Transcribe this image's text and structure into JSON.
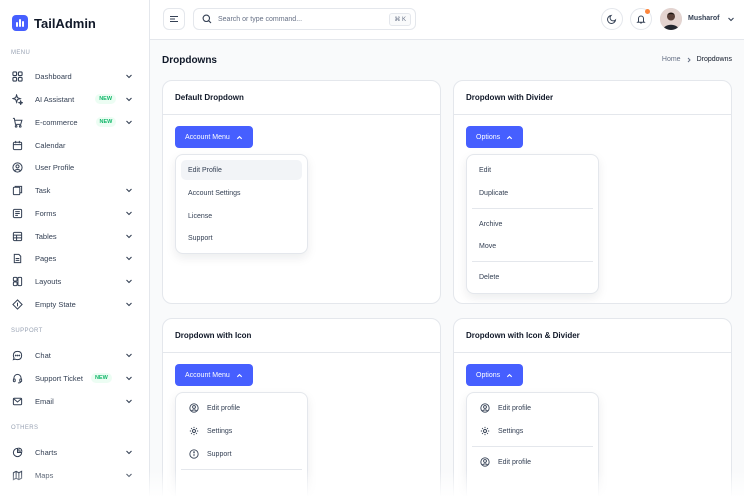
{
  "brand": {
    "name": "TailAdmin",
    "color": "#465fff"
  },
  "sidebar": {
    "sections": {
      "menu": "MENU",
      "support": "SUPPORT",
      "others": "OTHERS"
    },
    "items": [
      {
        "label": "Dashboard",
        "icon": "grid-icon",
        "badge": "",
        "chevron": true
      },
      {
        "label": "AI Assistant",
        "icon": "sparkle-icon",
        "badge": "NEW",
        "chevron": true
      },
      {
        "label": "E-commerce",
        "icon": "cart-icon",
        "badge": "NEW",
        "chevron": true
      },
      {
        "label": "Calendar",
        "icon": "calendar-icon",
        "badge": "",
        "chevron": false
      },
      {
        "label": "User Profile",
        "icon": "user-circle-icon",
        "badge": "",
        "chevron": false
      },
      {
        "label": "Task",
        "icon": "task-icon",
        "badge": "",
        "chevron": true
      },
      {
        "label": "Forms",
        "icon": "form-icon",
        "badge": "",
        "chevron": true
      },
      {
        "label": "Tables",
        "icon": "table-icon",
        "badge": "",
        "chevron": true
      },
      {
        "label": "Pages",
        "icon": "page-icon",
        "badge": "",
        "chevron": true
      },
      {
        "label": "Layouts",
        "icon": "layout-icon",
        "badge": "",
        "chevron": true
      },
      {
        "label": "Empty State",
        "icon": "empty-state-icon",
        "badge": "",
        "chevron": true
      },
      {
        "label": "Chat",
        "icon": "chat-icon",
        "badge": "",
        "chevron": true
      },
      {
        "label": "Support Ticket",
        "icon": "headset-icon",
        "badge": "NEW",
        "chevron": true
      },
      {
        "label": "Email",
        "icon": "mail-icon",
        "badge": "",
        "chevron": true
      },
      {
        "label": "Charts",
        "icon": "pie-chart-icon",
        "badge": "",
        "chevron": true
      },
      {
        "label": "Maps",
        "icon": "map-icon",
        "badge": "",
        "chevron": true
      }
    ]
  },
  "header": {
    "search_placeholder": "Search or type command...",
    "shortcut": "⌘ K",
    "user_name": "Musharof"
  },
  "page": {
    "title": "Dropdowns",
    "breadcrumb": {
      "home": "Home",
      "current": "Dropdowns"
    }
  },
  "cards": {
    "default": {
      "title": "Default Dropdown",
      "button": "Account Menu",
      "items": [
        "Edit Profile",
        "Account Settings",
        "License",
        "Support"
      ]
    },
    "divider": {
      "title": "Dropdown with Divider",
      "button": "Options",
      "items": [
        "Edit",
        "Duplicate",
        "Archive",
        "Move",
        "Delete"
      ]
    },
    "icon": {
      "title": "Dropdown with Icon",
      "button": "Account Menu",
      "items": [
        {
          "label": "Edit profile",
          "icon": "user-icon"
        },
        {
          "label": "Settings",
          "icon": "settings-icon"
        },
        {
          "label": "Support",
          "icon": "info-icon"
        }
      ]
    },
    "icon_divider": {
      "title": "Dropdown with Icon & Divider",
      "button": "Options",
      "items": [
        {
          "label": "Edit profile",
          "icon": "user-icon"
        },
        {
          "label": "Settings",
          "icon": "settings-icon"
        },
        {
          "label": "Edit profile",
          "icon": "user-icon"
        }
      ]
    }
  },
  "colors": {
    "accent": "#465fff",
    "new_badge": "#12b76a",
    "notification": "#fd853a"
  }
}
